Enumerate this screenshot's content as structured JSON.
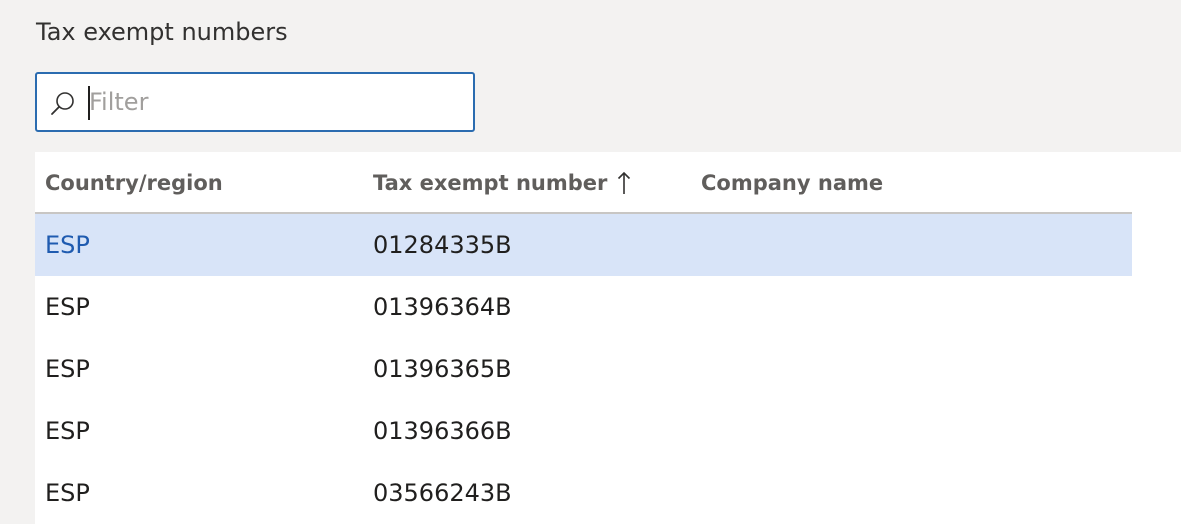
{
  "page": {
    "title": "Tax exempt numbers"
  },
  "filter": {
    "placeholder": "Filter",
    "value": ""
  },
  "grid": {
    "columns": [
      {
        "label": "Country/region"
      },
      {
        "label": "Tax exempt number",
        "sorted": "ascending"
      },
      {
        "label": "Company name"
      }
    ],
    "rows": [
      {
        "country": "ESP",
        "tax_exempt_number": "01284335B",
        "company_name": "",
        "selected": true
      },
      {
        "country": "ESP",
        "tax_exempt_number": "01396364B",
        "company_name": "",
        "selected": false
      },
      {
        "country": "ESP",
        "tax_exempt_number": "01396365B",
        "company_name": "",
        "selected": false
      },
      {
        "country": "ESP",
        "tax_exempt_number": "01396366B",
        "company_name": "",
        "selected": false
      },
      {
        "country": "ESP",
        "tax_exempt_number": "03566243B",
        "company_name": "",
        "selected": false
      }
    ]
  },
  "icons": {
    "search": "search-icon",
    "sort": "arrow-up-icon"
  },
  "colors": {
    "page_background": "#f3f2f1",
    "accent": "#2b6cb0",
    "selected_row": "#d8e4f8",
    "selected_text": "#1f5bb0"
  }
}
